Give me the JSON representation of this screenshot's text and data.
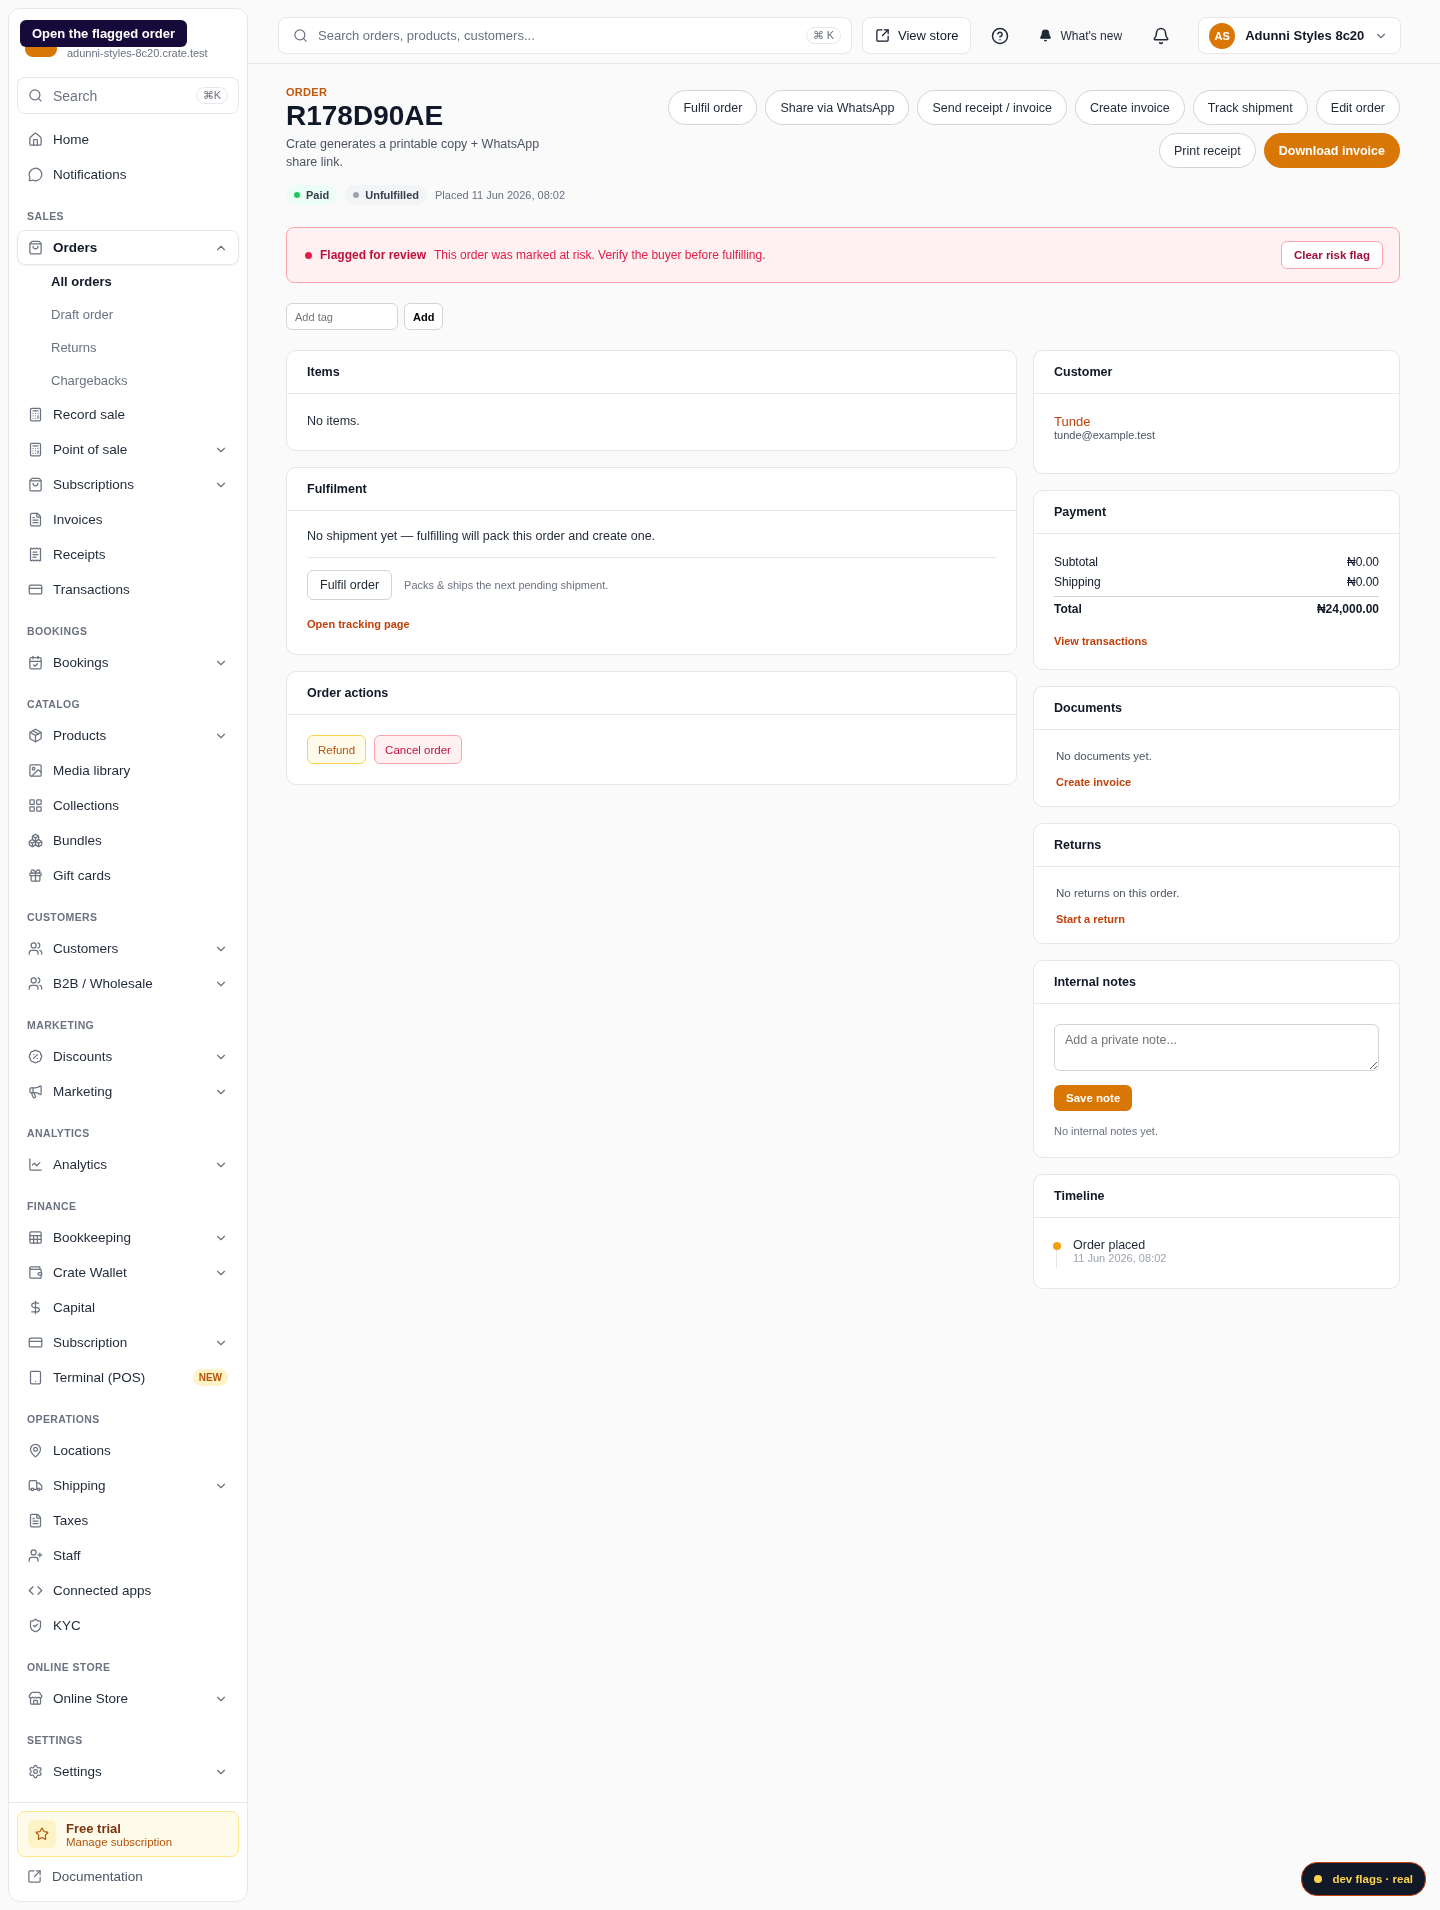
{
  "tooltip": "Open the flagged order",
  "sidebar": {
    "store_domain": "adunni-styles-8c20.crate.test",
    "search": {
      "placeholder": "Search",
      "shortcut": "⌘K"
    },
    "sections": [
      {
        "items": [
          {
            "label": "Home",
            "kind": "link",
            "selected": false
          },
          {
            "label": "Notifications",
            "kind": "link",
            "selected": false
          }
        ]
      },
      {
        "label": "SALES",
        "items": [
          {
            "label": "Orders",
            "kind": "group",
            "expanded": true,
            "selected": true,
            "children": [
              {
                "label": "All orders",
                "selected": true
              },
              {
                "label": "Draft order",
                "selected": false
              },
              {
                "label": "Returns",
                "selected": false
              },
              {
                "label": "Chargebacks",
                "selected": false
              }
            ]
          },
          {
            "label": "Record sale",
            "kind": "link",
            "selected": false
          },
          {
            "label": "Point of sale",
            "kind": "group",
            "expanded": false,
            "selected": false
          },
          {
            "label": "Subscriptions",
            "kind": "group",
            "expanded": false,
            "selected": false
          },
          {
            "label": "Invoices",
            "kind": "link",
            "selected": false
          },
          {
            "label": "Receipts",
            "kind": "link",
            "selected": false
          },
          {
            "label": "Transactions",
            "kind": "link",
            "selected": false
          }
        ]
      },
      {
        "label": "BOOKINGS",
        "items": [
          {
            "label": "Bookings",
            "kind": "group",
            "expanded": false,
            "selected": false
          }
        ]
      },
      {
        "label": "CATALOG",
        "items": [
          {
            "label": "Products",
            "kind": "group",
            "expanded": false,
            "selected": false
          },
          {
            "label": "Media library",
            "kind": "link",
            "selected": false
          },
          {
            "label": "Collections",
            "kind": "link",
            "selected": false
          },
          {
            "label": "Bundles",
            "kind": "link",
            "selected": false
          },
          {
            "label": "Gift cards",
            "kind": "link",
            "selected": false
          }
        ]
      },
      {
        "label": "CUSTOMERS",
        "items": [
          {
            "label": "Customers",
            "kind": "group",
            "expanded": false,
            "selected": false
          },
          {
            "label": "B2B / Wholesale",
            "kind": "group",
            "expanded": false,
            "selected": false
          }
        ]
      },
      {
        "label": "MARKETING",
        "items": [
          {
            "label": "Discounts",
            "kind": "group",
            "expanded": false,
            "selected": false
          },
          {
            "label": "Marketing",
            "kind": "group",
            "expanded": false,
            "selected": false
          }
        ]
      },
      {
        "label": "ANALYTICS",
        "items": [
          {
            "label": "Analytics",
            "kind": "group",
            "expanded": false,
            "selected": false
          }
        ]
      },
      {
        "label": "FINANCE",
        "items": [
          {
            "label": "Bookkeeping",
            "kind": "group",
            "expanded": false,
            "selected": false
          },
          {
            "label": "Crate Wallet",
            "kind": "group",
            "expanded": false,
            "selected": false
          },
          {
            "label": "Capital",
            "kind": "link",
            "selected": false
          },
          {
            "label": "Subscription",
            "kind": "group",
            "expanded": false,
            "selected": false
          },
          {
            "label": "Terminal (POS)",
            "kind": "link",
            "selected": false,
            "badge": "NEW"
          }
        ]
      },
      {
        "label": "OPERATIONS",
        "items": [
          {
            "label": "Locations",
            "kind": "link",
            "selected": false
          },
          {
            "label": "Shipping",
            "kind": "group",
            "expanded": false,
            "selected": false
          },
          {
            "label": "Taxes",
            "kind": "link",
            "selected": false
          },
          {
            "label": "Staff",
            "kind": "link",
            "selected": false
          },
          {
            "label": "Connected apps",
            "kind": "link",
            "selected": false
          },
          {
            "label": "KYC",
            "kind": "link",
            "selected": false
          }
        ]
      },
      {
        "label": "ONLINE STORE",
        "items": [
          {
            "label": "Online Store",
            "kind": "group",
            "expanded": false,
            "selected": false
          }
        ]
      },
      {
        "label": "SETTINGS",
        "items": [
          {
            "label": "Settings",
            "kind": "group",
            "expanded": false,
            "selected": false
          }
        ]
      }
    ],
    "trial": {
      "title": "Free trial",
      "link": "Manage subscription"
    },
    "footer_link": "Documentation"
  },
  "topbar": {
    "search": {
      "placeholder": "Search orders, products, customers...",
      "shortcut": "⌘ K"
    },
    "view_store": "View store",
    "whats_new": "What's new",
    "account": {
      "initials": "AS",
      "name": "Adunni Styles 8c20"
    }
  },
  "header": {
    "eyebrow": "ORDER",
    "title": "R178D90AE",
    "description": "Crate generates a printable copy + WhatsApp share link.",
    "actions": [
      {
        "label": "Fulfil order",
        "kind": "secondary"
      },
      {
        "label": "Share via WhatsApp",
        "kind": "secondary"
      },
      {
        "label": "Send receipt / invoice",
        "kind": "secondary"
      },
      {
        "label": "Create invoice",
        "kind": "secondary"
      },
      {
        "label": "Track shipment",
        "kind": "secondary"
      },
      {
        "label": "Edit order",
        "kind": "secondary"
      },
      {
        "label": "Print receipt",
        "kind": "secondary"
      },
      {
        "label": "Download invoice",
        "kind": "primary"
      }
    ],
    "statuses": [
      {
        "label": "Paid",
        "color": "#22c55e"
      },
      {
        "label": "Unfulfilled",
        "color": "#9ca3af"
      }
    ],
    "placed": "Placed 11 Jun 2026, 08:02"
  },
  "alert": {
    "title": "Flagged for review",
    "message": "This order was marked at risk. Verify the buyer before fulfilling.",
    "button": "Clear risk flag"
  },
  "tags": {
    "placeholder": "Add tag",
    "button": "Add"
  },
  "items_card": {
    "title": "Items",
    "empty": "No items."
  },
  "fulfilment": {
    "title": "Fulfilment",
    "message": "No shipment yet — fulfilling will pack this order and create one.",
    "button": "Fulfil order",
    "note": "Packs & ships the next pending shipment.",
    "link": "Open tracking page"
  },
  "order_actions": {
    "title": "Order actions",
    "buttons": [
      {
        "label": "Refund",
        "kind": "warning"
      },
      {
        "label": "Cancel order",
        "kind": "danger"
      }
    ]
  },
  "customer": {
    "title": "Customer",
    "name": "Tunde",
    "email": "tunde@example.test"
  },
  "payment": {
    "title": "Payment",
    "rows": [
      {
        "label": "Subtotal",
        "value": "₦0.00",
        "kind": "line"
      },
      {
        "label": "Shipping",
        "value": "₦0.00",
        "kind": "line"
      },
      {
        "label": "Total",
        "value": "₦24,000.00",
        "kind": "total"
      }
    ],
    "link": "View transactions"
  },
  "documents": {
    "title": "Documents",
    "empty": "No documents yet.",
    "link": "Create invoice"
  },
  "returns": {
    "title": "Returns",
    "empty": "No returns on this order.",
    "link": "Start a return"
  },
  "notes": {
    "title": "Internal notes",
    "placeholder": "Add a private note...",
    "button": "Save note",
    "empty": "No internal notes yet."
  },
  "timeline": {
    "title": "Timeline",
    "events": [
      {
        "title": "Order placed",
        "time": "11 Jun 2026, 08:02",
        "color": "#f59e0b"
      }
    ]
  },
  "dev_badge": "dev flags · real"
}
